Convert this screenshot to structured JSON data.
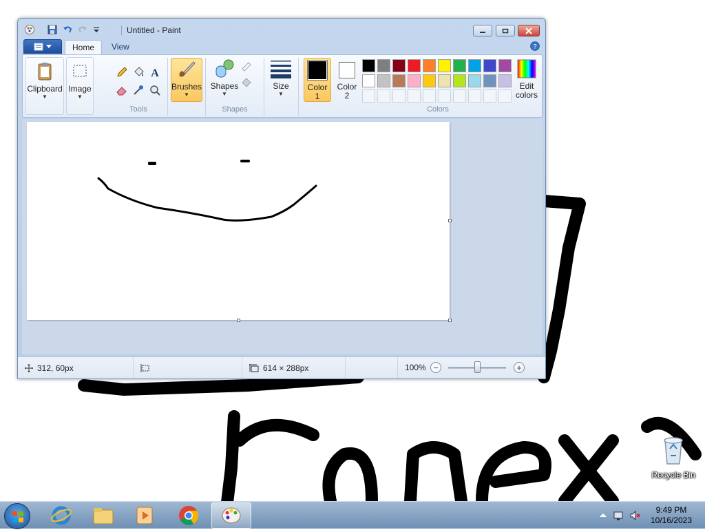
{
  "window": {
    "title": "Untitled - Paint"
  },
  "tabs": [
    {
      "label": "Home",
      "active": true
    },
    {
      "label": "View",
      "active": false
    }
  ],
  "ribbon": {
    "clipboard": {
      "label": "Clipboard"
    },
    "image": {
      "label": "Image"
    },
    "tools": {
      "group_label": "Tools"
    },
    "brushes": {
      "label": "Brushes",
      "selected": true
    },
    "shapes": {
      "label": "Shapes",
      "group_label": "Shapes"
    },
    "size": {
      "label": "Size"
    },
    "color1": {
      "label_line1": "Color",
      "label_line2": "1",
      "color": "#000000"
    },
    "color2": {
      "label_line1": "Color",
      "label_line2": "2",
      "color": "#ffffff"
    },
    "colors_group_label": "Colors",
    "edit_colors": {
      "label_line1": "Edit",
      "label_line2": "colors"
    },
    "palette_row1": [
      "#000000",
      "#7f7f7f",
      "#880015",
      "#ed1c24",
      "#ff7f27",
      "#fff200",
      "#22b14c",
      "#00a2e8",
      "#3f48cc",
      "#a349a4"
    ],
    "palette_row2": [
      "#ffffff",
      "#c3c3c3",
      "#b97a57",
      "#ffaec9",
      "#ffc90e",
      "#efe4b0",
      "#b5e61d",
      "#99d9ea",
      "#7092be",
      "#c8bfe7"
    ]
  },
  "status": {
    "cursor_position": "312, 60px",
    "canvas_size": "614 × 288px",
    "zoom": "100%",
    "zoom_level_fraction": 0.5
  },
  "desktop": {
    "recycle_bin_label": "Recycle Bin"
  },
  "taskbar": {
    "time": "9:49 PM",
    "date": "10/16/2023"
  }
}
